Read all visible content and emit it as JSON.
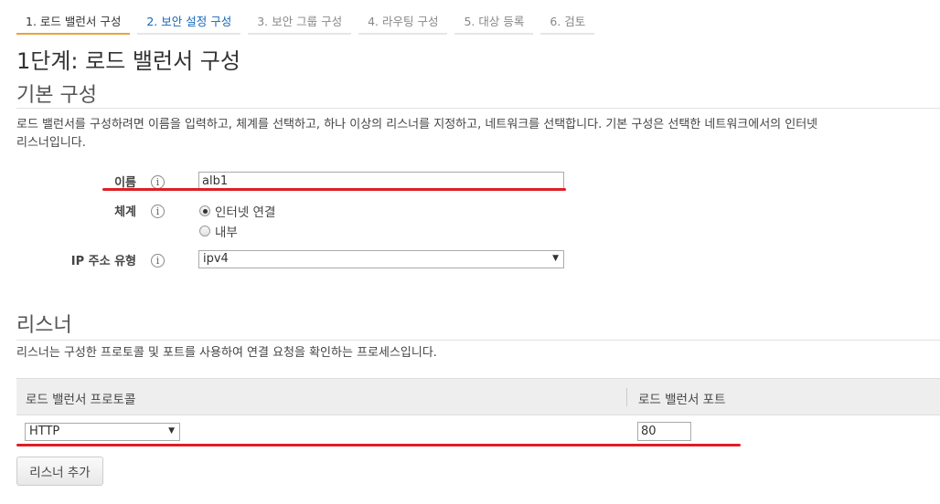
{
  "tabs": [
    {
      "label": "1. 로드 밸런서 구성"
    },
    {
      "label": "2. 보안 설정 구성"
    },
    {
      "label": "3. 보안 그룹 구성"
    },
    {
      "label": "4. 라우팅 구성"
    },
    {
      "label": "5. 대상 등록"
    },
    {
      "label": "6. 검토"
    }
  ],
  "page_title": "1단계: 로드 밸런서 구성",
  "basic": {
    "title": "기본 구성",
    "description_line1": "로드 밸런서를 구성하려면 이름을 입력하고, 체계를 선택하고, 하나 이상의 리스너를 지정하고, 네트워크를 선택합니다. 기본 구성은 선택한 네트워크에서의 인터넷",
    "description_line2": "리스너입니다.",
    "name_label": "이름",
    "name_value": "alb1",
    "scheme_label": "체계",
    "scheme_options": [
      "인터넷 연결",
      "내부"
    ],
    "ip_label": "IP 주소 유형",
    "ip_value": "ipv4",
    "info_glyph": "i"
  },
  "listeners": {
    "title": "리스너",
    "description": "리스너는 구성한 프로토콜 및 포트를 사용하여 연결 요청을 확인하는 프로세스입니다.",
    "col_protocol": "로드 밸런서 프로토콜",
    "col_port": "로드 밸런서 포트",
    "protocol_value": "HTTP",
    "port_value": "80",
    "add_button": "리스너 추가"
  },
  "icons": [
    "info-icon",
    "radio-selected",
    "radio-unselected",
    "dropdown-caret-icon"
  ],
  "colors": {
    "active_tab": "#e7a33e",
    "link": "#1166bb",
    "annotation": "#dd1f26"
  }
}
